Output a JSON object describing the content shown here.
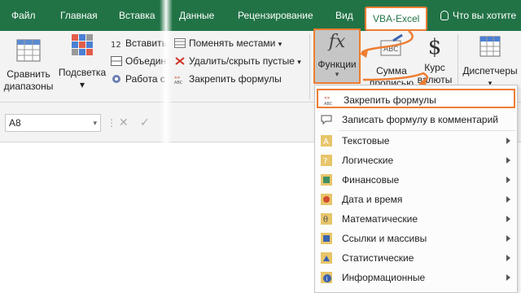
{
  "tabs": [
    {
      "label": "Файл"
    },
    {
      "label": "Главная"
    },
    {
      "label": "Вставка"
    },
    {
      "label": "Данные"
    },
    {
      "label": "Рецензирование"
    },
    {
      "label": "Вид"
    },
    {
      "label": "VBA-Excel"
    }
  ],
  "tell_me": "Что вы хотите",
  "ribbon": {
    "compare_line1": "Сравнить",
    "compare_line2": "диапазоны",
    "highlight_line1": "Подсветка",
    "small_buttons": [
      "Вставить",
      "Объедин",
      "Работа с"
    ],
    "swap": "Поменять местами",
    "delete_hide": "Удалить/скрыть пустые",
    "fix_formulas": "Закрепить формулы",
    "functions": "Функции",
    "sum_line1": "Сумма",
    "sum_line2": "прописью",
    "rate_line1": "Курс",
    "rate_line2": "валюты",
    "dispatchers": "Диспетчеры"
  },
  "formula_bar": {
    "name_box": "A8"
  },
  "menu": {
    "items": [
      {
        "label": "Закрепить формулы",
        "icon": "fix-formula-icon"
      },
      {
        "label": "Записать формулу в комментарий",
        "icon": "comment-icon"
      },
      {
        "label": "Текстовые",
        "icon": "text-category-icon"
      },
      {
        "label": "Логические",
        "icon": "logical-category-icon"
      },
      {
        "label": "Финансовые",
        "icon": "financial-category-icon"
      },
      {
        "label": "Дата и время",
        "icon": "datetime-category-icon"
      },
      {
        "label": "Математические",
        "icon": "math-category-icon"
      },
      {
        "label": "Ссылки и массивы",
        "icon": "reference-category-icon"
      },
      {
        "label": "Статистические",
        "icon": "statistics-category-icon"
      },
      {
        "label": "Информационные",
        "icon": "info-category-icon"
      }
    ]
  },
  "colors": {
    "excel_green": "#217346",
    "highlight_orange": "#ed7d31"
  }
}
